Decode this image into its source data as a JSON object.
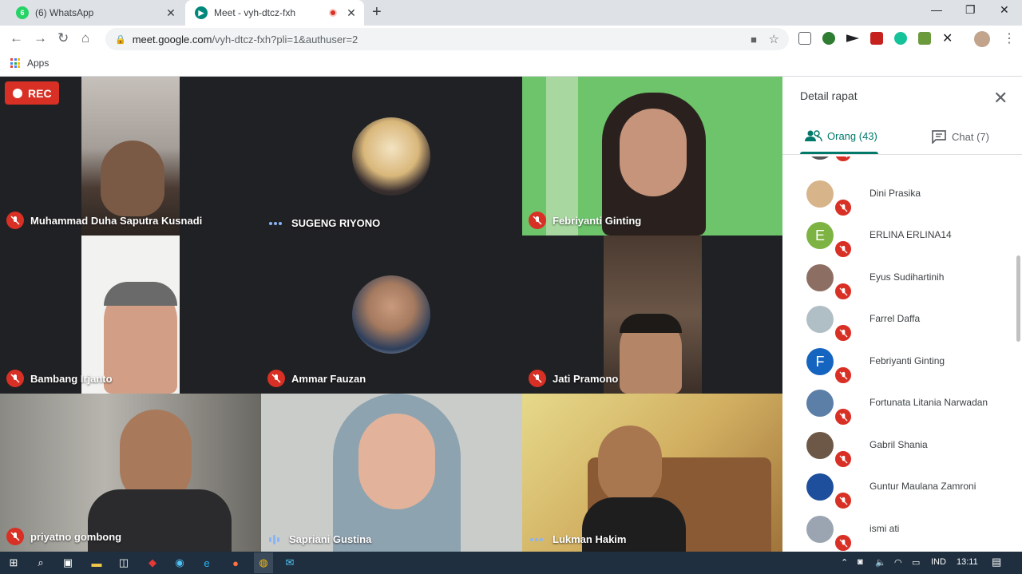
{
  "browser": {
    "tabs": [
      {
        "title": "(6) WhatsApp",
        "badge": "6",
        "active": false
      },
      {
        "title": "Meet - vyh-dtcz-fxh",
        "active": true
      }
    ],
    "new_tab": "+",
    "window_controls": {
      "minimize": "—",
      "maximize": "❐",
      "close": "✕"
    },
    "url_host": "meet.google.com",
    "url_path": "/vyh-dtcz-fxh?pli=1&authuser=2",
    "bookmarks_apps_label": "Apps"
  },
  "meeting": {
    "rec_label": "REC",
    "tiles": [
      {
        "name": "Muhammad Duha Saputra Kusnadi",
        "status": "muted"
      },
      {
        "name": "SUGENG RIYONO",
        "status": "dots"
      },
      {
        "name": "Febriyanti Ginting",
        "status": "muted"
      },
      {
        "name": "Bambang Irjanto",
        "status": "muted"
      },
      {
        "name": "Ammar Fauzan",
        "status": "muted"
      },
      {
        "name": "Jati Pramono",
        "status": "muted"
      },
      {
        "name": "priyatno gombong",
        "status": "muted"
      },
      {
        "name": "Sapriani Gustina",
        "status": "speaking"
      },
      {
        "name": "Lukman Hakim",
        "status": "dots"
      }
    ]
  },
  "panel": {
    "title": "Detail rapat",
    "tab_people": "Orang (43)",
    "tab_chat": "Chat (7)",
    "people": [
      {
        "name": "Dini Prasika",
        "initial": "",
        "color": "#d7b48a"
      },
      {
        "name": "ERLINA ERLINA14",
        "initial": "E",
        "color": "#7cb342"
      },
      {
        "name": "Eyus Sudihartinih",
        "initial": "",
        "color": "#8d6e63"
      },
      {
        "name": "Farrel Daffa",
        "initial": "",
        "color": "#b0bec5"
      },
      {
        "name": "Febriyanti Ginting",
        "initial": "F",
        "color": "#1565c0"
      },
      {
        "name": "Fortunata Litania Narwadan",
        "initial": "",
        "color": "#5c7fa8"
      },
      {
        "name": "Gabril Shania",
        "initial": "",
        "color": "#6d5847"
      },
      {
        "name": "Guntur Maulana Zamroni",
        "initial": "",
        "color": "#1e4f9c"
      },
      {
        "name": "ismi ati",
        "initial": "",
        "color": "#9aa5b1"
      }
    ]
  },
  "taskbar": {
    "lang": "IND",
    "time": "13:11"
  }
}
